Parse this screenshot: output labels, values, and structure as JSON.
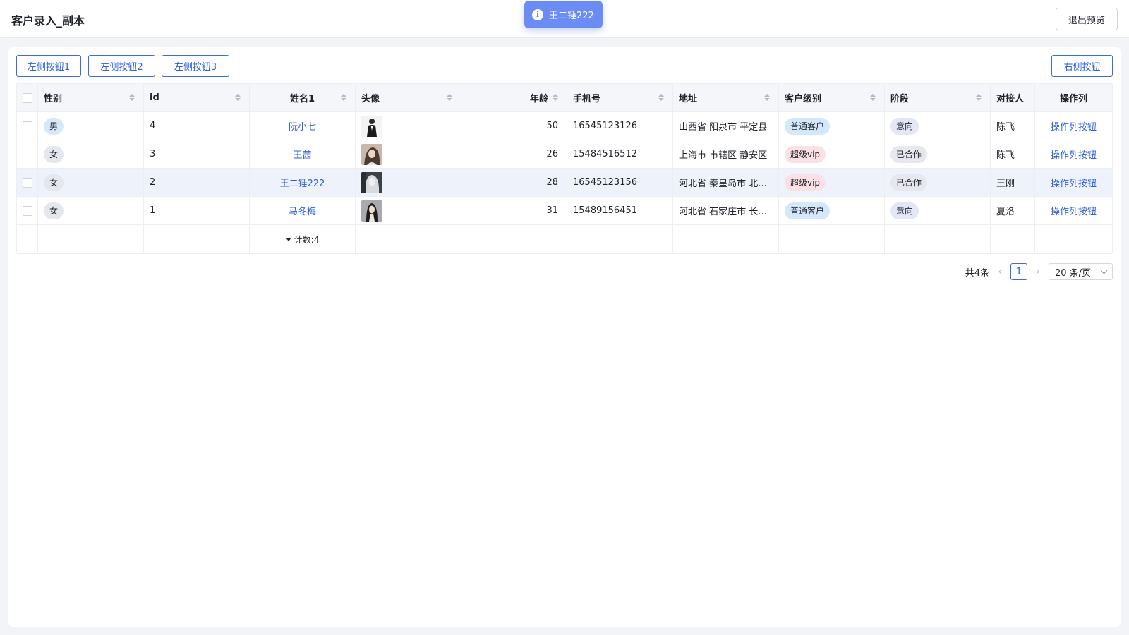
{
  "header": {
    "title": "客户录入_副本",
    "exit_label": "退出预览"
  },
  "toast": {
    "message": "王二锤222",
    "icon": "info-icon"
  },
  "toolbar": {
    "left_buttons": [
      "左侧按钮1",
      "左侧按钮2",
      "左侧按钮3"
    ],
    "right_button": "右侧按钮"
  },
  "table": {
    "columns": [
      "性别",
      "id",
      "姓名1",
      "头像",
      "年龄",
      "手机号",
      "地址",
      "客户级别",
      "阶段",
      "对接人",
      "操作列"
    ],
    "rows": [
      {
        "gender": "男",
        "id": "4",
        "name": "阮小七",
        "avatar": "avatar-man-suit",
        "age": "50",
        "phone": "16545123126",
        "address": "山西省 阳泉市 平定县",
        "level": "普通客户",
        "stage": "意向",
        "contact": "陈飞",
        "op": "操作列按钮"
      },
      {
        "gender": "女",
        "id": "3",
        "name": "王茜",
        "avatar": "avatar-woman-1",
        "age": "26",
        "phone": "15484516512",
        "address": "上海市 市辖区 静安区",
        "level": "超级vip",
        "stage": "已合作",
        "contact": "陈飞",
        "op": "操作列按钮"
      },
      {
        "gender": "女",
        "id": "2",
        "name": "王二锤222",
        "avatar": "avatar-woman-2",
        "age": "28",
        "phone": "16545123156",
        "address": "河北省 秦皇岛市 北...",
        "level": "超级vip",
        "stage": "已合作",
        "contact": "王刚",
        "op": "操作列按钮"
      },
      {
        "gender": "女",
        "id": "1",
        "name": "马冬梅",
        "avatar": "avatar-woman-3",
        "age": "31",
        "phone": "15489156451",
        "address": "河北省 石家庄市 长...",
        "level": "普通客户",
        "stage": "意向",
        "contact": "夏洛",
        "op": "操作列按钮"
      }
    ],
    "footer_count": "计数:4"
  },
  "pagination": {
    "total": "共4条",
    "current": "1",
    "page_size": "20 条/页"
  },
  "colors": {
    "primary": "#2f5fd9",
    "toast_bg": "#6b8cf5",
    "highlight_row": "#eef2fb"
  }
}
